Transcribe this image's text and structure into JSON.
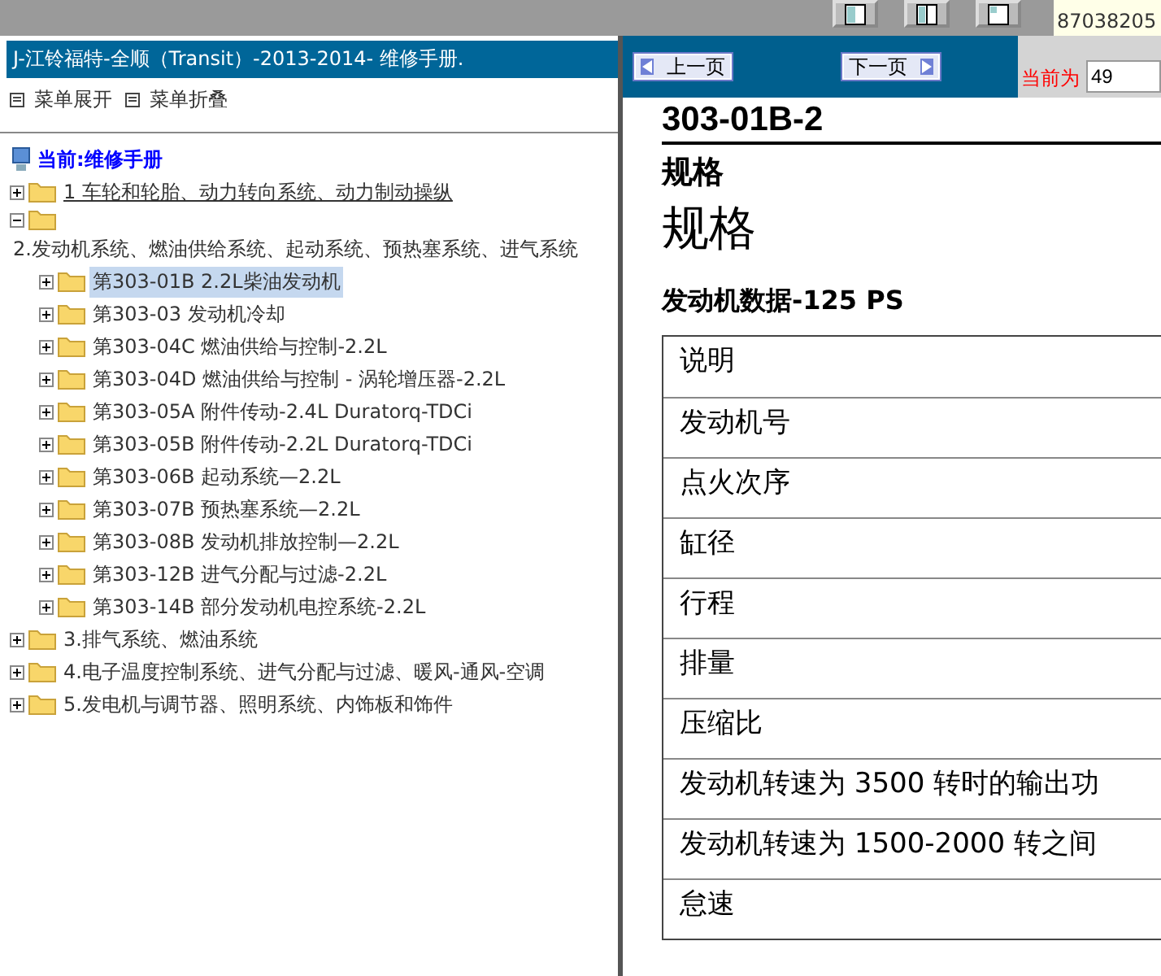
{
  "contact": {
    "number": "87038205"
  },
  "left": {
    "title": "J-江铃福特-全顺（Transit）-2013-2014- 维修手册.",
    "menu": [
      {
        "label": "菜单展开"
      },
      {
        "label": "菜单折叠"
      }
    ],
    "tree": {
      "root": "当前:维修手册",
      "items": [
        {
          "label": "1 车轮和轮胎、动力转向系统、动力制动操纵",
          "expanded": false,
          "hover": true
        },
        {
          "label": "2.发动机系统、燃油供给系统、起动系统、预热塞系统、进气系统",
          "expanded": true,
          "hover": false,
          "children": [
            {
              "label": "第303-01B 2.2L柴油发动机",
              "selected": true
            },
            {
              "label": "第303-03 发动机冷却",
              "selected": false
            },
            {
              "label": "第303-04C 燃油供给与控制-2.2L",
              "selected": false
            },
            {
              "label": "第303-04D 燃油供给与控制 - 涡轮增压器-2.2L",
              "selected": false
            },
            {
              "label": "第303-05A 附件传动-2.4L Duratorq-TDCi",
              "selected": false
            },
            {
              "label": "第303-05B 附件传动-2.2L Duratorq-TDCi",
              "selected": false
            },
            {
              "label": "第303-06B 起动系统—2.2L",
              "selected": false
            },
            {
              "label": "第303-07B 预热塞系统—2.2L",
              "selected": false
            },
            {
              "label": "第303-08B 发动机排放控制—2.2L",
              "selected": false
            },
            {
              "label": "第303-12B 进气分配与过滤-2.2L",
              "selected": false
            },
            {
              "label": "第303-14B 部分发动机电控系统-2.2L",
              "selected": false
            }
          ]
        },
        {
          "label": "3.排气系统、燃油系统",
          "expanded": false,
          "hover": false
        },
        {
          "label": "4.电子温度控制系统、进气分配与过滤、暖风-通风-空调",
          "expanded": false,
          "hover": false
        },
        {
          "label": "5.发电机与调节器、照明系统、内饰板和饰件",
          "expanded": false,
          "hover": false
        }
      ]
    }
  },
  "right": {
    "prev": "上一页",
    "next": "下一页",
    "page_label": "当前为",
    "page_value": "49",
    "doc_id": "303-01B-2",
    "section": "规格",
    "section_large": "规格",
    "table_title": "发动机数据-125 PS",
    "rows": [
      "说明",
      "发动机号",
      "点火次序",
      "缸径",
      "行程",
      "排量",
      "压缩比",
      "发动机转速为 3500 转时的输出功",
      "发动机转速为 1500-2000 转之间",
      "怠速"
    ]
  }
}
